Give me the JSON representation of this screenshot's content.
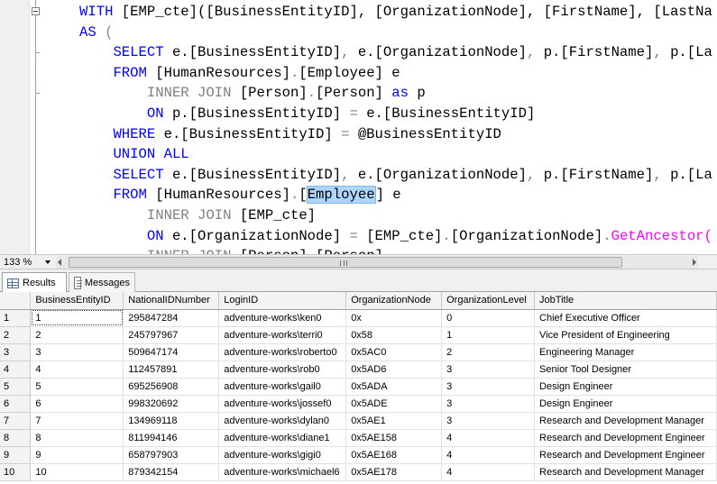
{
  "editor": {
    "lines": [
      [
        {
          "t": "WITH ",
          "c": "kw"
        },
        {
          "t": "[EMP_cte]([BusinessEntityID], [OrganizationNode], [FirstName], [LastNa",
          "c": "tx"
        }
      ],
      [
        {
          "t": "AS ",
          "c": "kw"
        },
        {
          "t": "(",
          "c": "gr"
        }
      ],
      [
        {
          "t": "    ",
          "c": "tx"
        },
        {
          "t": "SELECT ",
          "c": "kw"
        },
        {
          "t": "e.[BusinessEntityID]",
          "c": "tx"
        },
        {
          "t": ", ",
          "c": "gr"
        },
        {
          "t": "e.[OrganizationNode]",
          "c": "tx"
        },
        {
          "t": ", ",
          "c": "gr"
        },
        {
          "t": "p.[FirstName]",
          "c": "tx"
        },
        {
          "t": ", ",
          "c": "gr"
        },
        {
          "t": "p.[La",
          "c": "tx"
        }
      ],
      [
        {
          "t": "    ",
          "c": "tx"
        },
        {
          "t": "FROM ",
          "c": "kw"
        },
        {
          "t": "[HumanResources]",
          "c": "tx"
        },
        {
          "t": ".",
          "c": "gr"
        },
        {
          "t": "[Employee] e",
          "c": "tx"
        }
      ],
      [
        {
          "t": "        ",
          "c": "tx"
        },
        {
          "t": "INNER JOIN ",
          "c": "gr"
        },
        {
          "t": "[Person]",
          "c": "tx"
        },
        {
          "t": ".",
          "c": "gr"
        },
        {
          "t": "[Person] ",
          "c": "tx"
        },
        {
          "t": "as ",
          "c": "kw"
        },
        {
          "t": "p",
          "c": "tx"
        }
      ],
      [
        {
          "t": "        ",
          "c": "tx"
        },
        {
          "t": "ON ",
          "c": "kw"
        },
        {
          "t": "p.[BusinessEntityID] ",
          "c": "tx"
        },
        {
          "t": "= ",
          "c": "gr"
        },
        {
          "t": "e.[BusinessEntityID]",
          "c": "tx"
        }
      ],
      [
        {
          "t": "    ",
          "c": "tx"
        },
        {
          "t": "WHERE ",
          "c": "kw"
        },
        {
          "t": "e.[BusinessEntityID] ",
          "c": "tx"
        },
        {
          "t": "= ",
          "c": "gr"
        },
        {
          "t": "@BusinessEntityID",
          "c": "tx"
        }
      ],
      [
        {
          "t": "    ",
          "c": "tx"
        },
        {
          "t": "UNION ALL",
          "c": "kw"
        }
      ],
      [
        {
          "t": "    ",
          "c": "tx"
        },
        {
          "t": "SELECT ",
          "c": "kw"
        },
        {
          "t": "e.[BusinessEntityID]",
          "c": "tx"
        },
        {
          "t": ", ",
          "c": "gr"
        },
        {
          "t": "e.[OrganizationNode]",
          "c": "tx"
        },
        {
          "t": ", ",
          "c": "gr"
        },
        {
          "t": "p.[FirstName]",
          "c": "tx"
        },
        {
          "t": ", ",
          "c": "gr"
        },
        {
          "t": "p.[La",
          "c": "tx"
        }
      ],
      [
        {
          "t": "    ",
          "c": "tx"
        },
        {
          "t": "FROM ",
          "c": "kw"
        },
        {
          "t": "[HumanResources]",
          "c": "tx"
        },
        {
          "t": ".",
          "c": "gr"
        },
        {
          "t": "[",
          "c": "tx"
        },
        {
          "t": "Employee",
          "c": "hl"
        },
        {
          "t": "|",
          "c": "caret"
        },
        {
          "t": "] e",
          "c": "tx"
        }
      ],
      [
        {
          "t": "        ",
          "c": "tx"
        },
        {
          "t": "INNER JOIN ",
          "c": "gr"
        },
        {
          "t": "[EMP_cte]",
          "c": "tx"
        }
      ],
      [
        {
          "t": "        ",
          "c": "tx"
        },
        {
          "t": "ON ",
          "c": "kw"
        },
        {
          "t": "e.[OrganizationNode] ",
          "c": "tx"
        },
        {
          "t": "= ",
          "c": "gr"
        },
        {
          "t": "[EMP_cte]",
          "c": "tx"
        },
        {
          "t": ".",
          "c": "gr"
        },
        {
          "t": "[OrganizationNode]",
          "c": "tx"
        },
        {
          "t": ".",
          "c": "gr"
        },
        {
          "t": "GetAncestor(",
          "c": "fn"
        }
      ],
      [
        {
          "t": "        ",
          "c": "tx"
        },
        {
          "t": "INNER JOIN ",
          "c": "gr"
        },
        {
          "t": "[Person]",
          "c": "tx"
        },
        {
          "t": ".",
          "c": "gr"
        },
        {
          "t": "[Person] ",
          "c": "tx"
        }
      ]
    ]
  },
  "zoom": {
    "value": "133 %"
  },
  "tabs": [
    {
      "label": "Results",
      "icon": "grid-icon",
      "active": true
    },
    {
      "label": "Messages",
      "icon": "messages-icon",
      "active": false
    }
  ],
  "results": {
    "columns": [
      "BusinessEntityID",
      "NationalIDNumber",
      "LoginID",
      "OrganizationNode",
      "OrganizationLevel",
      "JobTitle"
    ],
    "rows": [
      [
        "1",
        "1",
        "295847284",
        "adventure-works\\ken0",
        "0x",
        "0",
        "Chief Executive Officer"
      ],
      [
        "2",
        "2",
        "245797967",
        "adventure-works\\terri0",
        "0x58",
        "1",
        "Vice President of Engineering"
      ],
      [
        "3",
        "3",
        "509647174",
        "adventure-works\\roberto0",
        "0x5AC0",
        "2",
        "Engineering Manager"
      ],
      [
        "4",
        "4",
        "112457891",
        "adventure-works\\rob0",
        "0x5AD6",
        "3",
        "Senior Tool Designer"
      ],
      [
        "5",
        "5",
        "695256908",
        "adventure-works\\gail0",
        "0x5ADA",
        "3",
        "Design Engineer"
      ],
      [
        "6",
        "6",
        "998320692",
        "adventure-works\\jossef0",
        "0x5ADE",
        "3",
        "Design Engineer"
      ],
      [
        "7",
        "7",
        "134969118",
        "adventure-works\\dylan0",
        "0x5AE1",
        "3",
        "Research and Development Manager"
      ],
      [
        "8",
        "8",
        "811994146",
        "adventure-works\\diane1",
        "0x5AE158",
        "4",
        "Research and Development Engineer"
      ],
      [
        "9",
        "9",
        "658797903",
        "adventure-works\\gigi0",
        "0x5AE168",
        "4",
        "Research and Development Engineer"
      ],
      [
        "10",
        "10",
        "879342154",
        "adventure-works\\michael6",
        "0x5AE178",
        "4",
        "Research and Development Manager"
      ]
    ]
  },
  "colors": {
    "keyword": "#0000ff",
    "operator": "#808080",
    "function": "#ff00ff",
    "highlight": "#add6ff"
  }
}
